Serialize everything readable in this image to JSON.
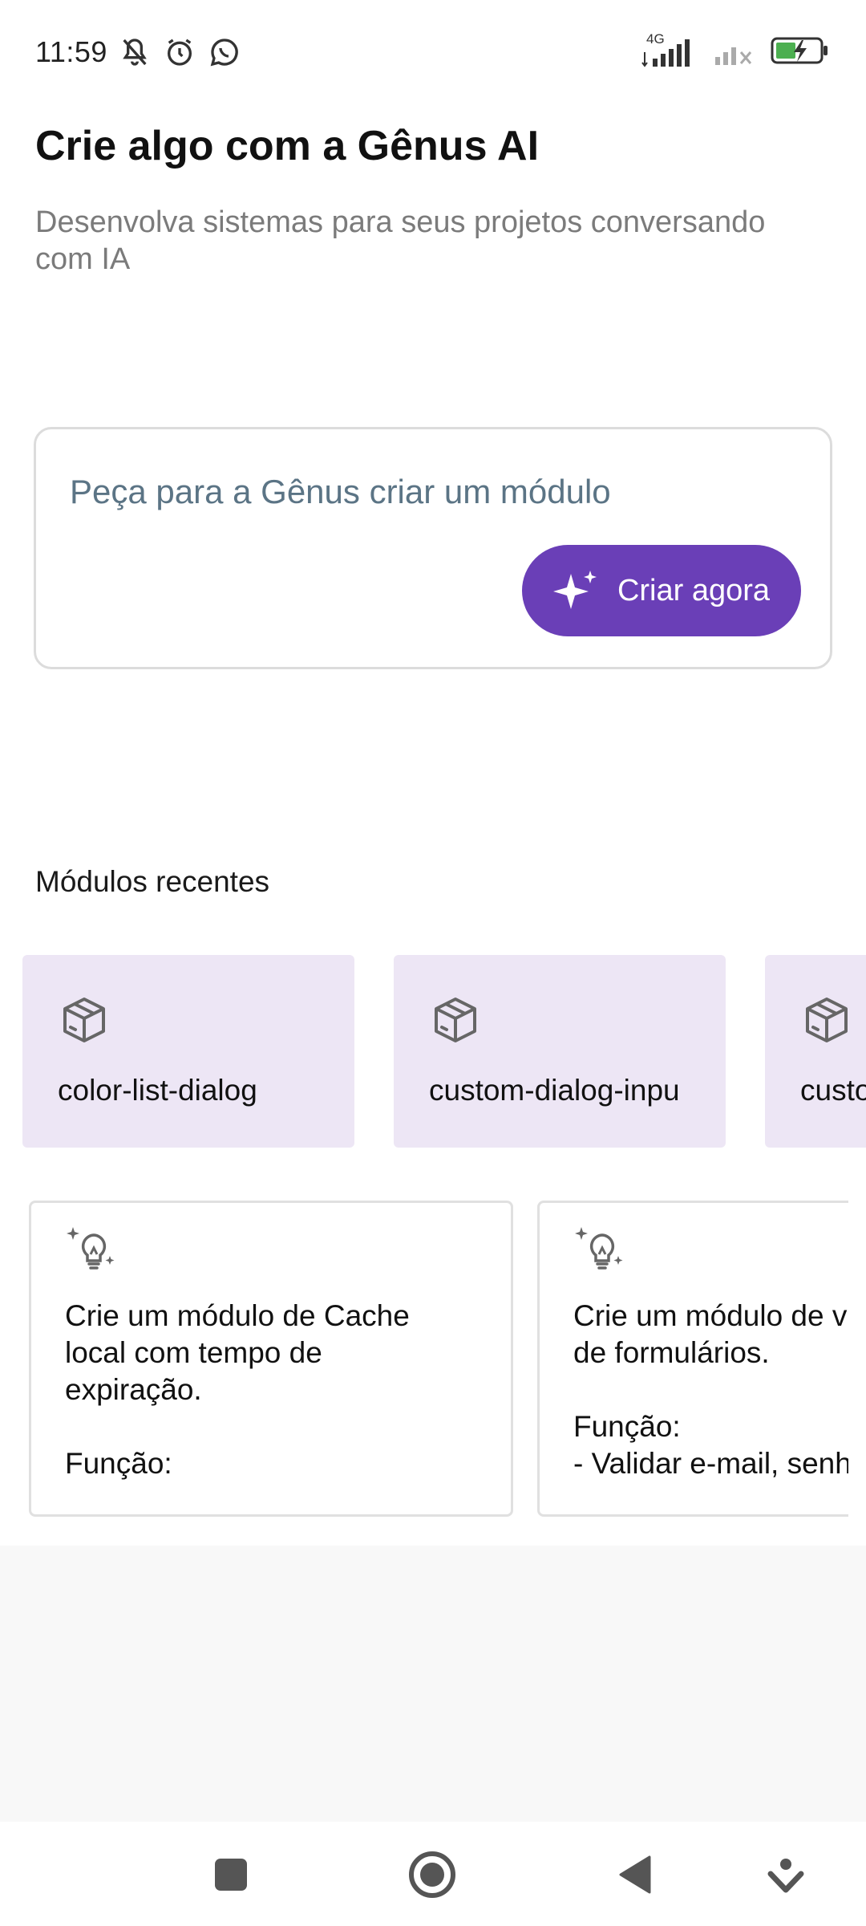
{
  "status_bar": {
    "time": "11:59",
    "network_label": "4G",
    "icons": [
      "mute-icon",
      "alarm-icon",
      "whatsapp-icon",
      "signal-icon",
      "signal-no-sim-icon",
      "battery-charging-icon"
    ]
  },
  "header": {
    "title": "Crie algo com a Gênus AI",
    "subtitle": "Desenvolva sistemas para seus projetos conversando com IA"
  },
  "prompt": {
    "placeholder": "Peça para a Gênus criar um módulo",
    "button_label": "Criar agora"
  },
  "recent": {
    "label": "Módulos recentes",
    "modules": [
      {
        "name": "color-list-dialog"
      },
      {
        "name": "custom-dialog-inpu"
      },
      {
        "name": "custo"
      }
    ]
  },
  "suggestions": [
    {
      "text": "Crie um módulo de Cache\nlocal com tempo de\nexpiração.\n\nFunção:"
    },
    {
      "text": "Crie um módulo de v\nde formulários.\n\nFunção:\n- Validar e-mail, senh"
    }
  ],
  "colors": {
    "accent": "#6a3fb7",
    "module_card_bg": "#ede6f5",
    "placeholder": "#5b7485"
  },
  "navbar": {
    "icons": [
      "recents-square-icon",
      "home-circle-icon",
      "back-triangle-icon",
      "assistant-down-icon"
    ]
  }
}
